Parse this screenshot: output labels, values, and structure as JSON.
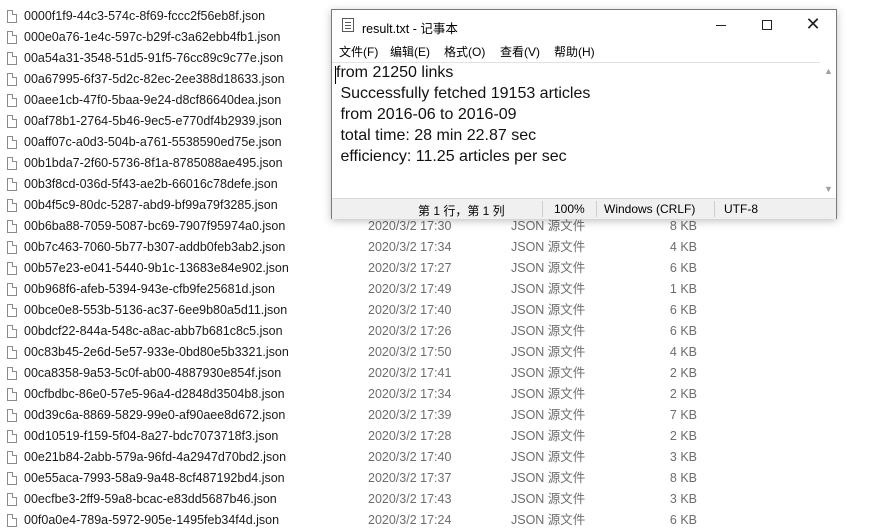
{
  "explorer": {
    "files": [
      {
        "name": "0000f1f9-44c3-574c-8f69-fccc2f56eb8f.json",
        "date": "",
        "type": "",
        "size": ""
      },
      {
        "name": "000e0a76-1e4c-597c-b29f-c3a62ebb4fb1.json",
        "date": "",
        "type": "",
        "size": ""
      },
      {
        "name": "00a54a31-3548-51d5-91f5-76cc89c9c77e.json",
        "date": "",
        "type": "",
        "size": ""
      },
      {
        "name": "00a67995-6f37-5d2c-82ec-2ee388d18633.json",
        "date": "",
        "type": "",
        "size": ""
      },
      {
        "name": "00aee1cb-47f0-5baa-9e24-d8cf86640dea.json",
        "date": "",
        "type": "",
        "size": ""
      },
      {
        "name": "00af78b1-2764-5b46-9ec5-e770df4b2939.json",
        "date": "",
        "type": "",
        "size": ""
      },
      {
        "name": "00aff07c-a0d3-504b-a761-5538590ed75e.json",
        "date": "",
        "type": "",
        "size": ""
      },
      {
        "name": "00b1bda7-2f60-5736-8f1a-8785088ae495.json",
        "date": "",
        "type": "",
        "size": ""
      },
      {
        "name": "00b3f8cd-036d-5f43-ae2b-66016c78defe.json",
        "date": "",
        "type": "",
        "size": ""
      },
      {
        "name": "00b4f5c9-80dc-5287-abd9-bf99a79f3285.json",
        "date": "",
        "type": "",
        "size": ""
      },
      {
        "name": "00b6ba88-7059-5087-bc69-7907f95974a0.json",
        "date": "2020/3/2 17:30",
        "type": "JSON 源文件",
        "size": "8 KB"
      },
      {
        "name": "00b7c463-7060-5b77-b307-addb0feb3ab2.json",
        "date": "2020/3/2 17:34",
        "type": "JSON 源文件",
        "size": "4 KB"
      },
      {
        "name": "00b57e23-e041-5440-9b1c-13683e84e902.json",
        "date": "2020/3/2 17:27",
        "type": "JSON 源文件",
        "size": "6 KB"
      },
      {
        "name": "00b968f6-afeb-5394-943e-cfb9fe25681d.json",
        "date": "2020/3/2 17:49",
        "type": "JSON 源文件",
        "size": "1 KB"
      },
      {
        "name": "00bce0e8-553b-5136-ac37-6ee9b80a5d11.json",
        "date": "2020/3/2 17:40",
        "type": "JSON 源文件",
        "size": "6 KB"
      },
      {
        "name": "00bdcf22-844a-548c-a8ac-abb7b681c8c5.json",
        "date": "2020/3/2 17:26",
        "type": "JSON 源文件",
        "size": "6 KB"
      },
      {
        "name": "00c83b45-2e6d-5e57-933e-0bd80e5b3321.json",
        "date": "2020/3/2 17:50",
        "type": "JSON 源文件",
        "size": "4 KB"
      },
      {
        "name": "00ca8358-9a53-5c0f-ab00-4887930e854f.json",
        "date": "2020/3/2 17:41",
        "type": "JSON 源文件",
        "size": "2 KB"
      },
      {
        "name": "00cfbdbc-86e0-57e5-96a4-d2848d3504b8.json",
        "date": "2020/3/2 17:34",
        "type": "JSON 源文件",
        "size": "2 KB"
      },
      {
        "name": "00d39c6a-8869-5829-99e0-af90aee8d672.json",
        "date": "2020/3/2 17:39",
        "type": "JSON 源文件",
        "size": "7 KB"
      },
      {
        "name": "00d10519-f159-5f04-8a27-bdc7073718f3.json",
        "date": "2020/3/2 17:28",
        "type": "JSON 源文件",
        "size": "2 KB"
      },
      {
        "name": "00e21b84-2abb-579a-96fd-4a2947d70bd2.json",
        "date": "2020/3/2 17:40",
        "type": "JSON 源文件",
        "size": "3 KB"
      },
      {
        "name": "00e55aca-7993-58a9-9a48-8cf487192bd4.json",
        "date": "2020/3/2 17:37",
        "type": "JSON 源文件",
        "size": "8 KB"
      },
      {
        "name": "00ecfbe3-2ff9-59a8-bcac-e83dd5687b46.json",
        "date": "2020/3/2 17:43",
        "type": "JSON 源文件",
        "size": "3 KB"
      },
      {
        "name": "00f0a0e4-789a-5972-905e-1495feb34f4d.json",
        "date": "2020/3/2 17:24",
        "type": "JSON 源文件",
        "size": "6 KB"
      }
    ]
  },
  "notepad": {
    "title": "result.txt - 记事本",
    "menu": {
      "file": "文件(F)",
      "edit": "编辑(E)",
      "format": "格式(O)",
      "view": "查看(V)",
      "help": "帮助(H)"
    },
    "lines": [
      "from 21250 links",
      " Successfully fetched 19153 articles",
      " from 2016-06 to 2016-09",
      " total time: 28 min 22.87 sec",
      " efficiency: 11.25 articles per sec"
    ],
    "status": {
      "position": "第 1 行，第 1 列",
      "zoom": "100%",
      "line_ending": "Windows (CRLF)",
      "encoding": "UTF-8"
    },
    "icons": {
      "app": "notepad-icon",
      "minimize": "minimize-icon",
      "maximize": "maximize-icon",
      "close": "close-icon"
    }
  }
}
